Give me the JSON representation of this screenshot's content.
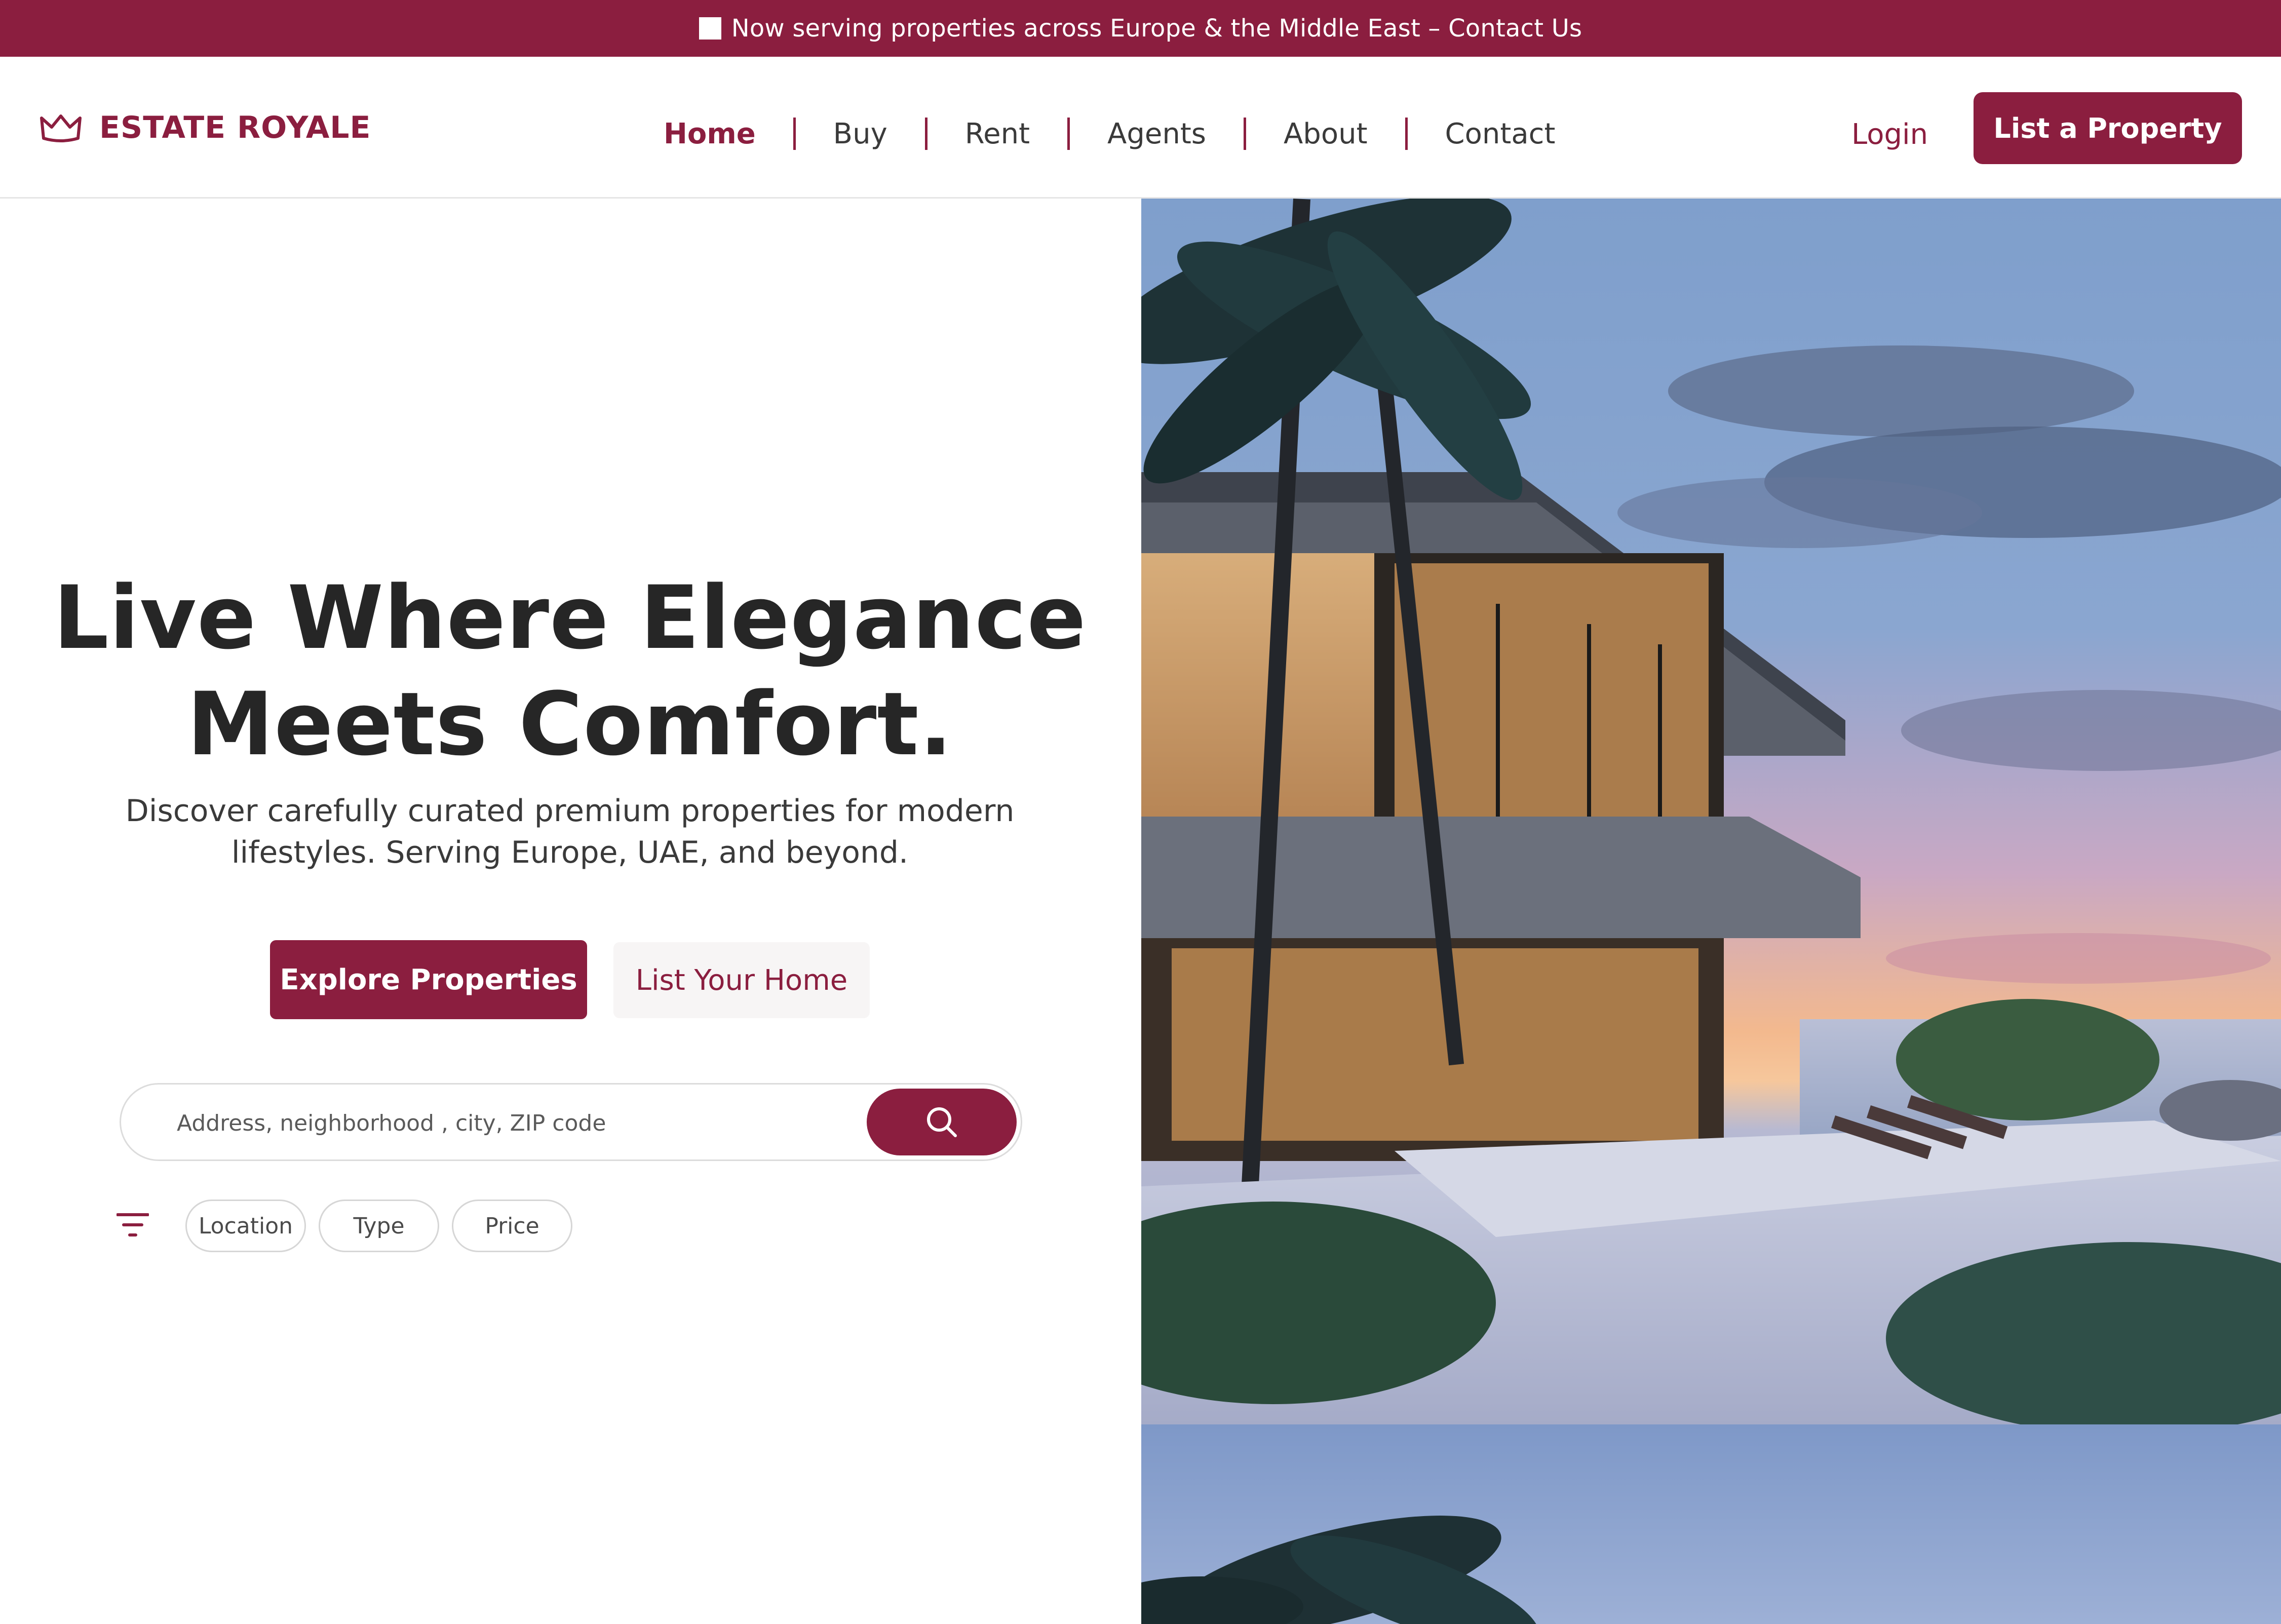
{
  "announcement": {
    "text": "Now serving properties across Europe & the Middle East – Contact Us"
  },
  "brand": {
    "name": "ESTATE ROYALE",
    "icon": "crown-icon",
    "color": "#8b1e3f"
  },
  "nav": {
    "items": [
      {
        "label": "Home",
        "active": true
      },
      {
        "label": "Buy",
        "active": false
      },
      {
        "label": "Rent",
        "active": false
      },
      {
        "label": "Agents",
        "active": false
      },
      {
        "label": "About",
        "active": false
      },
      {
        "label": "Contact",
        "active": false
      }
    ]
  },
  "header_actions": {
    "login_label": "Login",
    "list_property_label": "List a Property"
  },
  "hero": {
    "title_line1": "Live Where Elegance",
    "title_line2": "Meets Comfort.",
    "subtitle_line1": "Discover carefully curated premium properties for modern",
    "subtitle_line2": "lifestyles. Serving Europe, UAE, and beyond.",
    "primary_button": "Explore Properties",
    "secondary_button": "List Your Home"
  },
  "search": {
    "placeholder": "Address, neighborhood , city, ZIP code",
    "value": "",
    "button_icon": "search-icon"
  },
  "filters": {
    "icon": "filter-icon",
    "chips": [
      "Location",
      "Type",
      "Price"
    ]
  },
  "theme": {
    "accent": "#8b1e3f",
    "text": "#262626",
    "muted": "#3a3a3a"
  }
}
